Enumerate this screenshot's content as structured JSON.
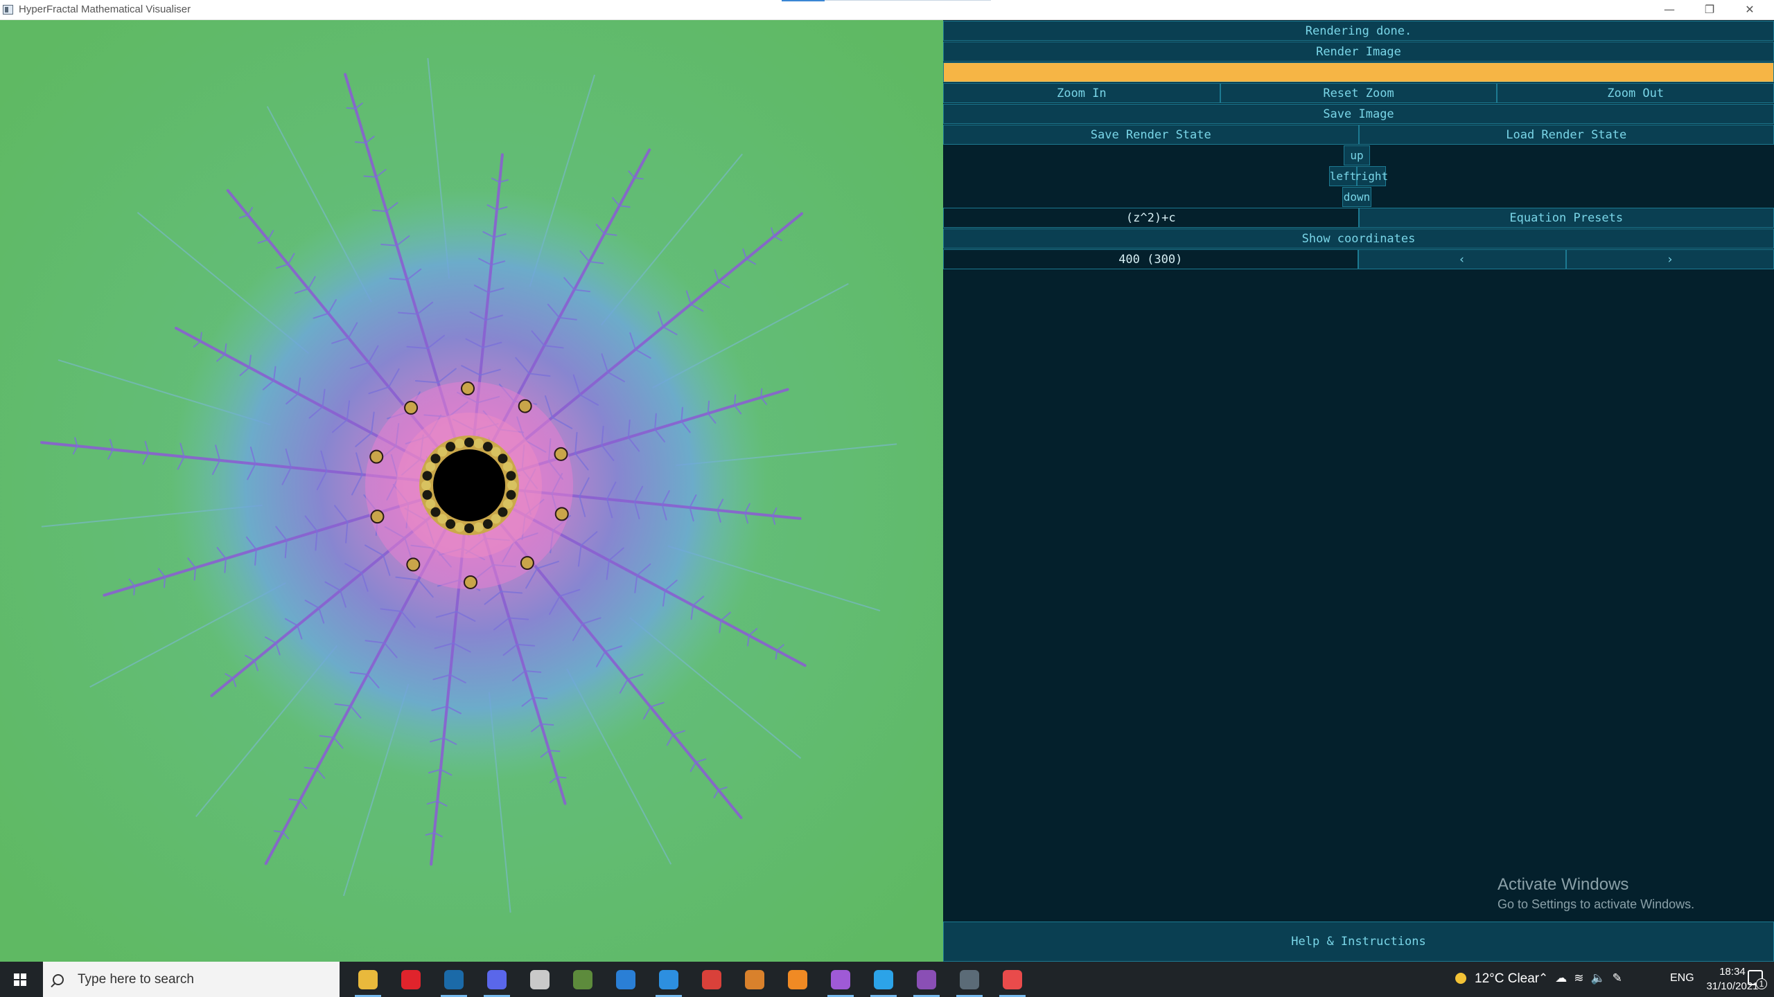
{
  "window": {
    "title": "HyperFractal Mathematical Visualiser",
    "minimize_glyph": "—",
    "maximize_glyph": "❐",
    "close_glyph": "✕"
  },
  "panel": {
    "status": "Rendering done.",
    "render_button": "Render Image",
    "progress": 1.0,
    "zoom_in": "Zoom In",
    "reset_zoom": "Reset Zoom",
    "zoom_out": "Zoom Out",
    "save_image": "Save Image",
    "save_state": "Save Render State",
    "load_state": "Load Render State",
    "pad": {
      "up": "up",
      "left": "left",
      "right": "right",
      "down": "down"
    },
    "equation": "(z^2)+c",
    "equation_presets": "Equation Presets",
    "show_coordinates": "Show coordinates",
    "iterations": "400 (300)",
    "prev": "‹",
    "next": "›",
    "help": "Help & Instructions"
  },
  "watermark": {
    "line1": "Activate Windows",
    "line2": "Go to Settings to activate Windows."
  },
  "taskbar": {
    "search_placeholder": "Type here to search",
    "apps": [
      {
        "icon": "file-explorer-icon",
        "color": "#e9b93c"
      },
      {
        "icon": "opera-icon",
        "color": "#e0242c"
      },
      {
        "icon": "steam-icon",
        "color": "#1b6aa8"
      },
      {
        "icon": "discord-icon",
        "color": "#5a67ea"
      },
      {
        "icon": "photos-icon",
        "color": "#c9c9c9"
      },
      {
        "icon": "minecraft-icon",
        "color": "#5d8b3c"
      },
      {
        "icon": "mail-icon",
        "color": "#2a7fd6"
      },
      {
        "icon": "vscode-icon",
        "color": "#2d8fe0"
      },
      {
        "icon": "todoist-icon",
        "color": "#d9413a"
      },
      {
        "icon": "settings-gear-icon",
        "color": "#d9812c"
      },
      {
        "icon": "blender-icon",
        "color": "#f08a24"
      },
      {
        "icon": "pen-tool-icon",
        "color": "#9f5ad6"
      },
      {
        "icon": "chat-app-icon",
        "color": "#2ca3e8"
      },
      {
        "icon": "github-desktop-icon",
        "color": "#8a4fb5"
      },
      {
        "icon": "terminal-icon",
        "color": "#5b6b77"
      },
      {
        "icon": "hyperfractal-icon",
        "color": "#e94b4b"
      }
    ],
    "weather": "12°C  Clear",
    "language": "ENG",
    "time": "18:34",
    "date": "31/10/2021",
    "notifications": "1"
  }
}
